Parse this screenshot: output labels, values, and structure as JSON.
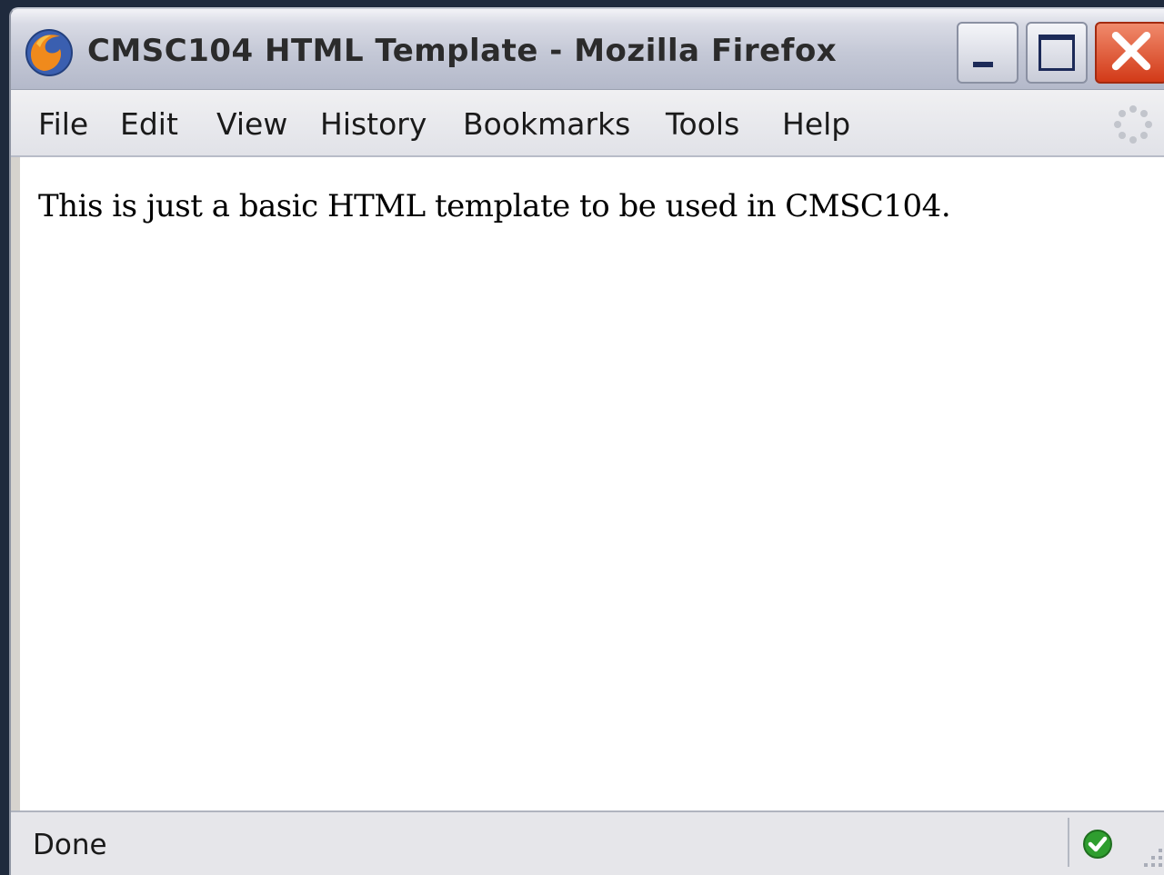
{
  "window": {
    "title": "CMSC104 HTML Template - Mozilla Firefox",
    "app_icon": "firefox-icon",
    "controls": [
      "minimize-icon",
      "maximize-icon",
      "close-icon"
    ]
  },
  "menubar": {
    "items": [
      {
        "label": "File"
      },
      {
        "label": "Edit"
      },
      {
        "label": "View"
      },
      {
        "label": "History"
      },
      {
        "label": "Bookmarks"
      },
      {
        "label": "Tools"
      },
      {
        "label": "Help"
      }
    ],
    "activity_icon": "throbber-icon"
  },
  "content": {
    "text": "This is just a basic HTML template to be used in CMSC104."
  },
  "statusbar": {
    "text": "Done",
    "status_icon": "checkmark-icon",
    "status_color": "#2f9e2f"
  },
  "colors": {
    "close_button": "#d23a18",
    "titlebar": "#c4c8d6",
    "title_text": "#2b2b2b"
  }
}
